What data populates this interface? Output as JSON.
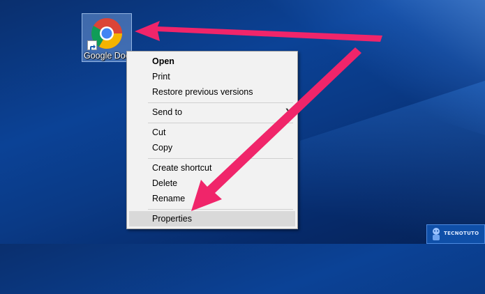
{
  "desktop": {
    "icon_label": "Google Doc"
  },
  "context_menu": {
    "groups": [
      [
        {
          "label": "Open",
          "bold": true
        },
        {
          "label": "Print"
        },
        {
          "label": "Restore previous versions"
        }
      ],
      [
        {
          "label": "Send to",
          "submenu": true
        }
      ],
      [
        {
          "label": "Cut"
        },
        {
          "label": "Copy"
        }
      ],
      [
        {
          "label": "Create shortcut"
        },
        {
          "label": "Delete"
        },
        {
          "label": "Rename"
        }
      ],
      [
        {
          "label": "Properties",
          "highlighted": true
        }
      ]
    ]
  },
  "watermark": {
    "text": "TECNOTUTO"
  },
  "colors": {
    "annotation_arrow": "#f0256a",
    "menu_background": "#f2f2f2",
    "menu_highlight": "#d9d9d9",
    "desktop_blue": "#0b4296"
  },
  "icons": [
    "chrome-icon",
    "shortcut-arrow-icon",
    "submenu-chevron-icon"
  ]
}
